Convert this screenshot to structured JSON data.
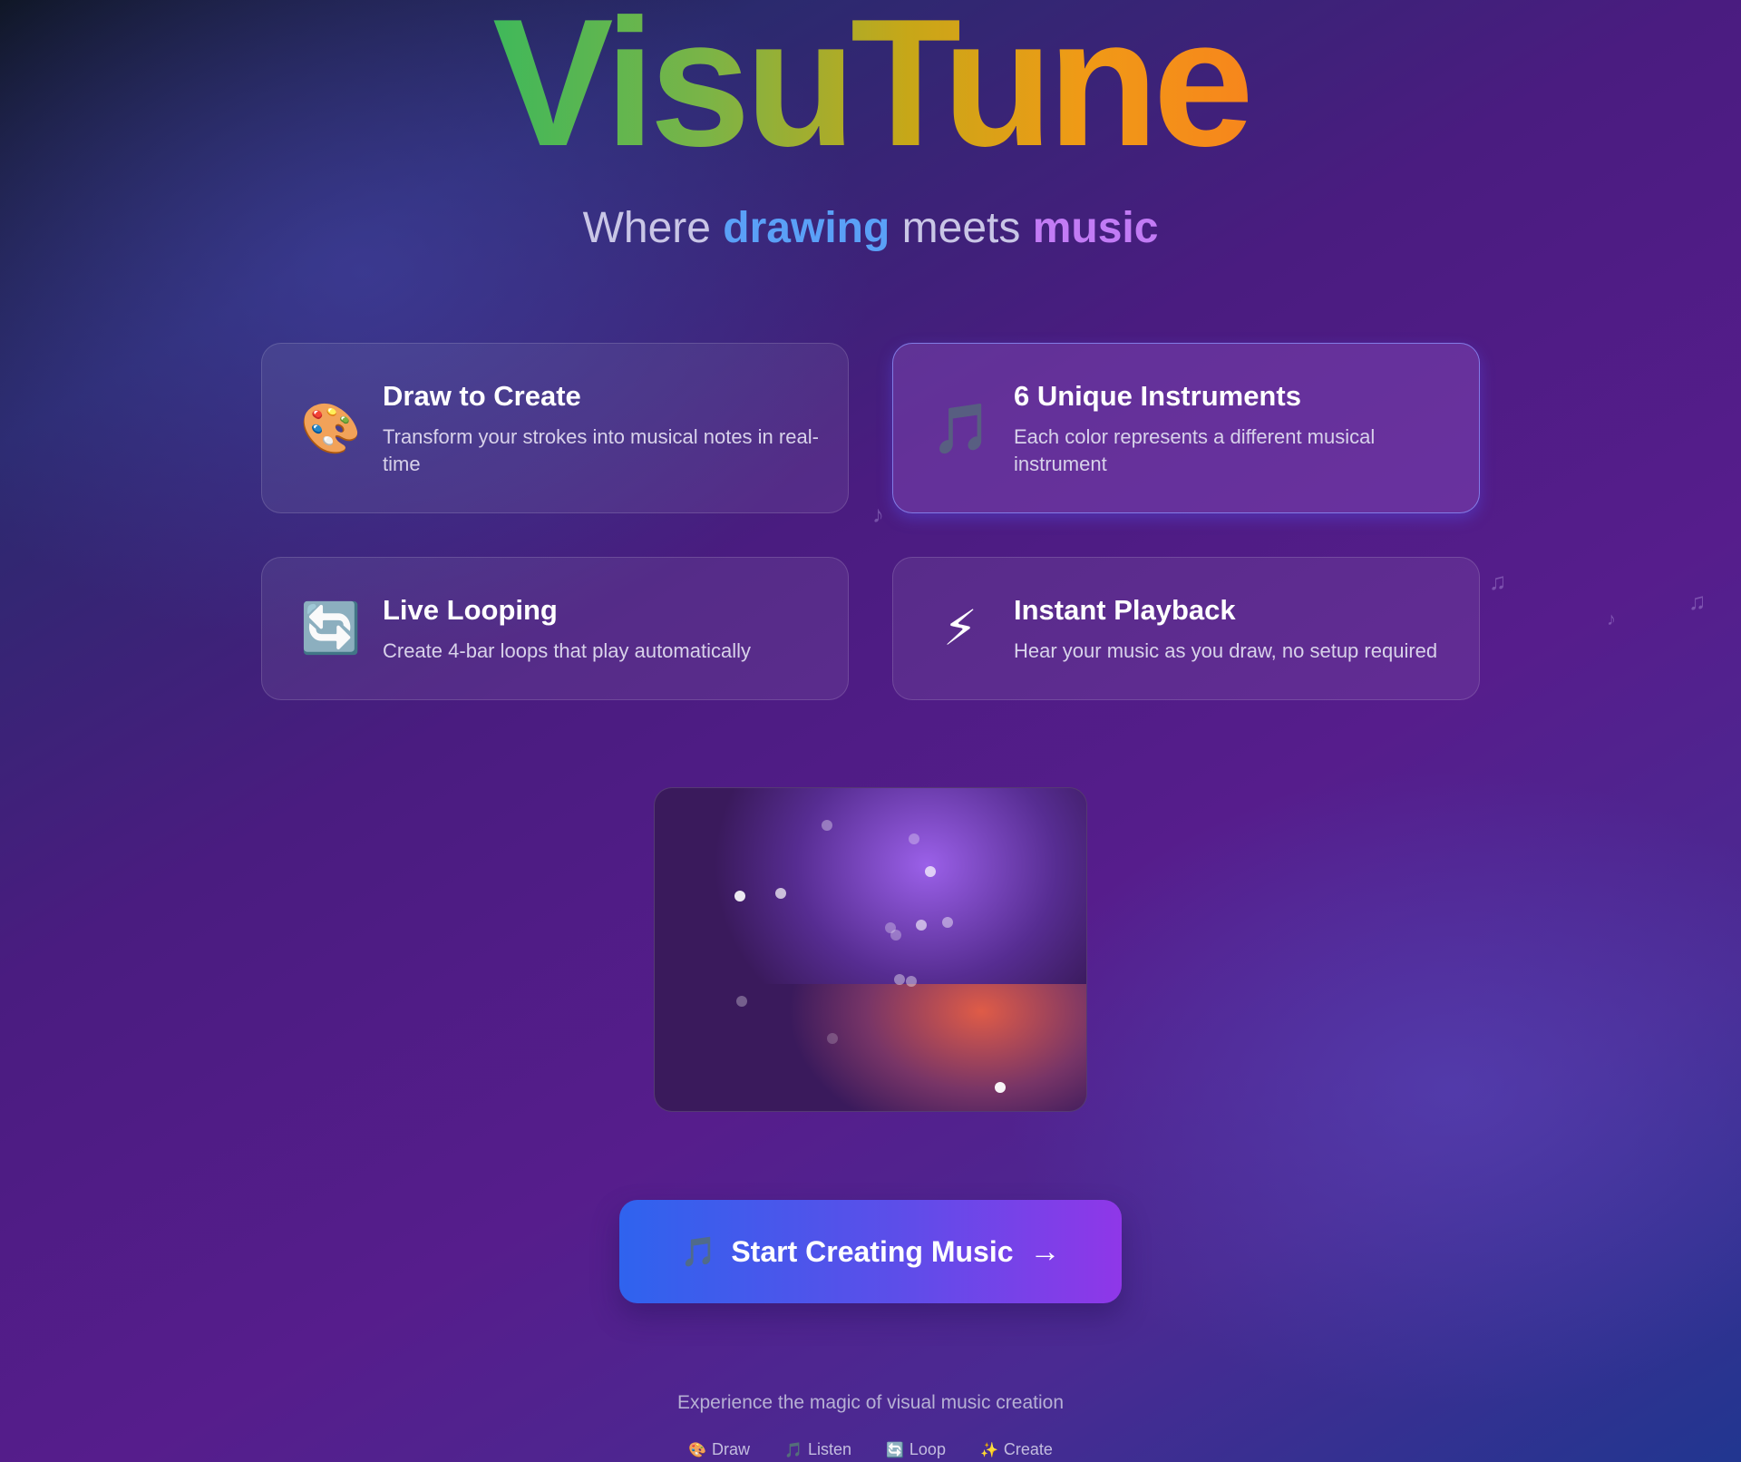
{
  "hero": {
    "title": "VisuTune",
    "subtitle_pre": "Where ",
    "subtitle_word1": "drawing",
    "subtitle_mid": " meets ",
    "subtitle_word2": "music"
  },
  "features": [
    {
      "icon": "🎨",
      "icon_name": "palette-icon",
      "title": "Draw to Create",
      "desc": "Transform your strokes into musical notes in real-time"
    },
    {
      "icon": "🎵",
      "icon_name": "music-note-icon",
      "title": "6 Unique Instruments",
      "desc": "Each color represents a different musical instrument"
    },
    {
      "icon": "🔄",
      "icon_name": "loop-icon",
      "title": "Live Looping",
      "desc": "Create 4-bar loops that play automatically"
    },
    {
      "icon": "⚡",
      "icon_name": "lightning-icon",
      "title": "Instant Playback",
      "desc": "Hear your music as you draw, no setup required"
    }
  ],
  "cta": {
    "icon": "🎵",
    "label": "Start Creating Music",
    "arrow": "→"
  },
  "footer": {
    "tagline": "Experience the magic of visual music creation",
    "chips": [
      {
        "icon": "🎨",
        "label": "Draw"
      },
      {
        "icon": "🎵",
        "label": "Listen"
      },
      {
        "icon": "🔄",
        "label": "Loop"
      },
      {
        "icon": "✨",
        "label": "Create"
      }
    ]
  },
  "colors": {
    "accent_blue": "#5aa0f7",
    "accent_purple": "#c27bf5",
    "cta_start": "#2f63ee",
    "cta_end": "#8f37e8"
  }
}
